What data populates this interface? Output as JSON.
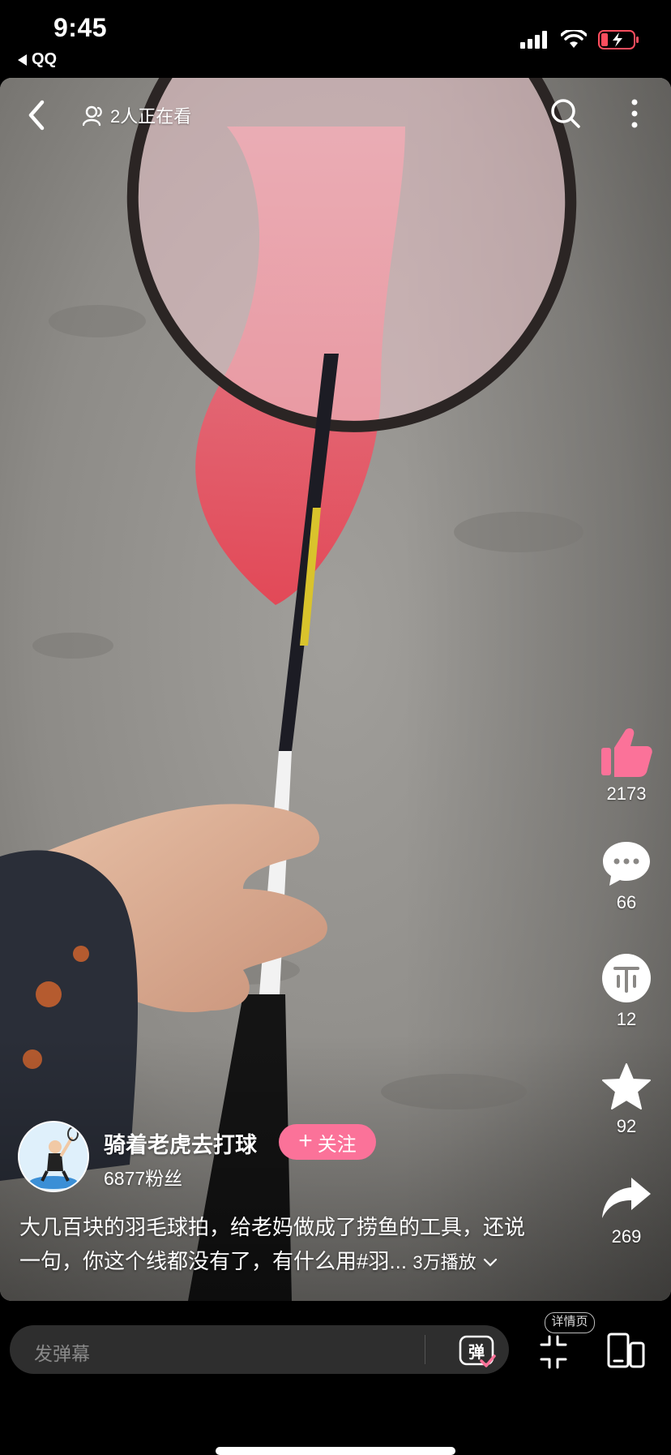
{
  "status_bar": {
    "time": "9:45",
    "back_app": "QQ",
    "icons": [
      "cellular-signal-icon",
      "wifi-icon",
      "battery-charging-icon"
    ]
  },
  "video": {
    "watchers": "2人正在看",
    "icons": [
      "back-chevron-icon",
      "people-icon",
      "search-icon",
      "more-vertical-icon"
    ]
  },
  "side_actions": [
    {
      "name": "like",
      "icon": "thumbs-up-icon",
      "count": "2173",
      "color": "#fb7299"
    },
    {
      "name": "comment",
      "icon": "comment-bubble-icon",
      "count": "66"
    },
    {
      "name": "coin",
      "icon": "coin-icon",
      "count": "12"
    },
    {
      "name": "favorite",
      "icon": "star-icon",
      "count": "92"
    },
    {
      "name": "share",
      "icon": "share-arrow-icon",
      "count": "269"
    }
  ],
  "author": {
    "name": "骑着老虎去打球",
    "fans": "6877粉丝",
    "follow_label": "关注",
    "follow_color": "#fb7299"
  },
  "description": {
    "line1": "大几百块的羽毛球拍，给老妈做成了捞鱼的工具，还说",
    "line2": "一句，你这个线都没有了，有什么用#羽...",
    "plays": "3万播放"
  },
  "bottom_bar": {
    "danmaku_placeholder": "发弹幕",
    "danmaku_toggle": "弹",
    "details_tip": "详情页",
    "icons": [
      "collapse-arrows-icon",
      "device-switch-icon"
    ]
  }
}
